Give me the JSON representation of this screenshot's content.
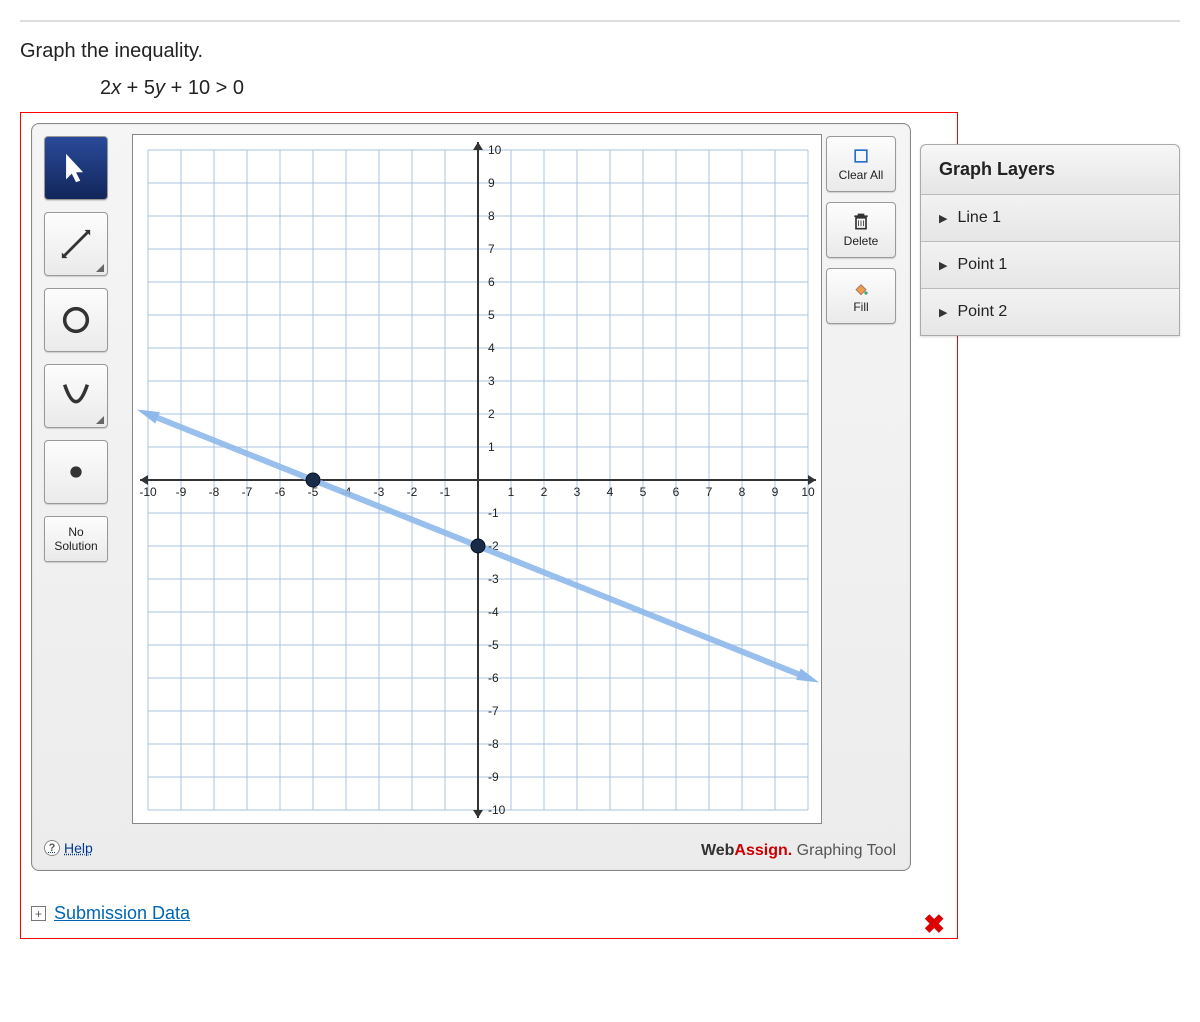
{
  "question": {
    "prompt": "Graph the inequality.",
    "equation_plain": "2x + 5y + 10 > 0"
  },
  "toolbox": {
    "no_solution_line1": "No",
    "no_solution_line2": "Solution",
    "help_label": "Help"
  },
  "side_buttons": {
    "clear_all": "Clear All",
    "delete": "Delete",
    "fill": "Fill"
  },
  "layers": {
    "title": "Graph Layers",
    "items": [
      {
        "label": "Line 1"
      },
      {
        "label": "Point 1"
      },
      {
        "label": "Point 2"
      }
    ]
  },
  "brand": {
    "web": "Web",
    "assign": "Assign.",
    "tail": " Graphing Tool"
  },
  "submission": {
    "label": "Submission Data"
  },
  "chart_data": {
    "type": "line",
    "xlabel": "",
    "ylabel": "",
    "xlim": [
      -10,
      10
    ],
    "ylim": [
      -10,
      10
    ],
    "grid": true,
    "x_ticks": [
      -10,
      -9,
      -8,
      -7,
      -6,
      -5,
      -4,
      -3,
      -2,
      -1,
      1,
      2,
      3,
      4,
      5,
      6,
      7,
      8,
      9,
      10
    ],
    "y_ticks": [
      -10,
      -9,
      -8,
      -7,
      -6,
      -5,
      -4,
      -3,
      -2,
      -1,
      1,
      2,
      3,
      4,
      5,
      6,
      7,
      8,
      9,
      10
    ],
    "line": {
      "description": "2x + 5y + 10 = 0",
      "style": "dashed-ish/solid blue",
      "points_on_line_for_draw": [
        [
          -10,
          2
        ],
        [
          10,
          -6
        ]
      ]
    },
    "plotted_points": [
      {
        "x": -5,
        "y": 0,
        "style": "filled"
      },
      {
        "x": 0,
        "y": -2,
        "style": "filled"
      }
    ]
  }
}
